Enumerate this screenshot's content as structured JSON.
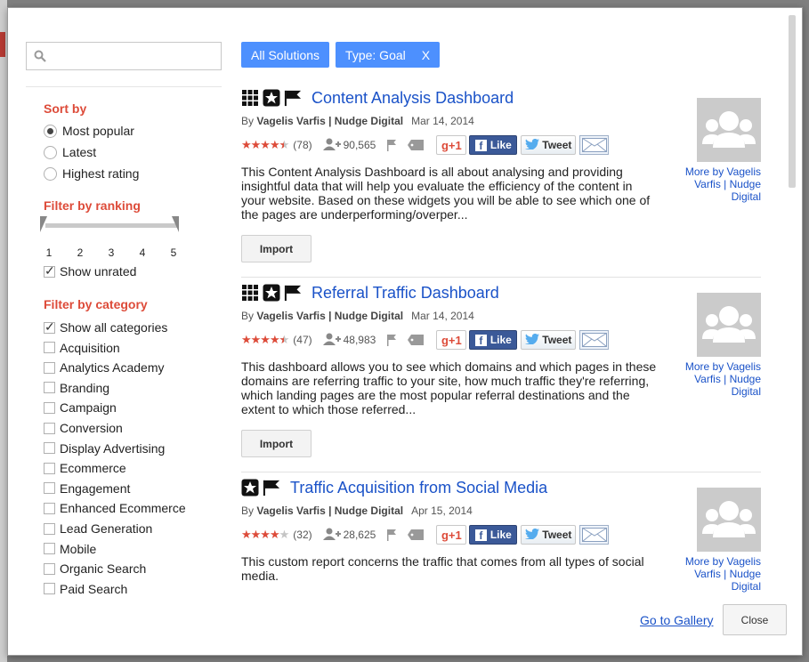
{
  "search": {
    "placeholder": ""
  },
  "sort": {
    "heading": "Sort by",
    "options": [
      {
        "label": "Most popular",
        "selected": true
      },
      {
        "label": "Latest",
        "selected": false
      },
      {
        "label": "Highest rating",
        "selected": false
      }
    ]
  },
  "ranking": {
    "heading": "Filter by ranking",
    "ticks": [
      "1",
      "2",
      "3",
      "4",
      "5"
    ],
    "range": [
      1,
      5
    ],
    "show_unrated_label": "Show unrated",
    "show_unrated_checked": true
  },
  "category": {
    "heading": "Filter by category",
    "items": [
      {
        "label": "Show all categories",
        "checked": true
      },
      {
        "label": "Acquisition",
        "checked": false
      },
      {
        "label": "Analytics Academy",
        "checked": false
      },
      {
        "label": "Branding",
        "checked": false
      },
      {
        "label": "Campaign",
        "checked": false
      },
      {
        "label": "Conversion",
        "checked": false
      },
      {
        "label": "Display Advertising",
        "checked": false
      },
      {
        "label": "Ecommerce",
        "checked": false
      },
      {
        "label": "Engagement",
        "checked": false
      },
      {
        "label": "Enhanced Ecommerce",
        "checked": false
      },
      {
        "label": "Lead Generation",
        "checked": false
      },
      {
        "label": "Mobile",
        "checked": false
      },
      {
        "label": "Organic Search",
        "checked": false
      },
      {
        "label": "Paid Search",
        "checked": false
      }
    ]
  },
  "chips": {
    "all_solutions": "All Solutions",
    "type_goal": "Type: Goal",
    "type_goal_remove": "X"
  },
  "results": [
    {
      "title": "Content Analysis Dashboard",
      "icons": [
        "grid-icon",
        "star-badge-icon",
        "flag-icon"
      ],
      "by_prefix": "By",
      "author": "Vagelis Varfis | Nudge Digital",
      "date": "Mar 14, 2014",
      "rating": 4.5,
      "rating_count": "(78)",
      "users": "90,565",
      "gplus": "g+1",
      "like": "Like",
      "tweet": "Tweet",
      "description": "This Content Analysis Dashboard is all about analysing and providing insightful data that will help you evaluate the efficiency of the content in your website. Based on these widgets you will be able to see which one of the pages are underperforming/overper...",
      "import": "Import",
      "more": "More by Vagelis Varfis | Nudge Digital"
    },
    {
      "title": "Referral Traffic Dashboard",
      "icons": [
        "grid-icon",
        "star-badge-icon",
        "flag-icon"
      ],
      "by_prefix": "By",
      "author": "Vagelis Varfis | Nudge Digital",
      "date": "Mar 14, 2014",
      "rating": 4.5,
      "rating_count": "(47)",
      "users": "48,983",
      "gplus": "g+1",
      "like": "Like",
      "tweet": "Tweet",
      "description": "This dashboard allows you to see which domains and which pages in these domains are referring traffic to your site, how much traffic they're referring, which landing pages are the most popular referral destinations and the extent to which those referred...",
      "import": "Import",
      "more": "More by Vagelis Varfis | Nudge Digital"
    },
    {
      "title": "Traffic Acquisition from Social Media",
      "icons": [
        "star-badge-icon",
        "flag-icon"
      ],
      "by_prefix": "By",
      "author": "Vagelis Varfis | Nudge Digital",
      "date": "Apr 15, 2014",
      "rating": 4,
      "rating_count": "(32)",
      "users": "28,625",
      "gplus": "g+1",
      "like": "Like",
      "tweet": "Tweet",
      "description": "This custom report concerns the traffic that comes from all types of social media.",
      "import": "Import",
      "more": "More by Vagelis Varfis | Nudge Digital"
    }
  ],
  "footer": {
    "goto_gallery": "Go to Gallery",
    "close": "Close"
  },
  "colors": {
    "accent_red": "#dd4b39",
    "chip_blue": "#4d90fe",
    "link_blue": "#1a52c8",
    "facebook": "#3b5998"
  }
}
